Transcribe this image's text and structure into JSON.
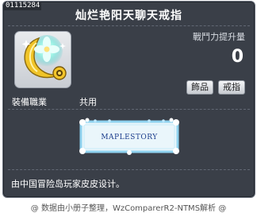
{
  "item": {
    "id": "01115284",
    "name": "灿烂艳阳天聊天戒指",
    "stat_label": "戰鬥力提升量",
    "stat_value": "0",
    "tags": [
      "飾品",
      "戒指"
    ],
    "job_label": "裝備職業",
    "job_value": "共用",
    "ring_text": "MAPLESTORY",
    "description": "由中国冒险岛玩家皮皮设计。"
  },
  "footer": {
    "text": "@ 数据由小册子整理，WzComparerR2-NTMS解析 @"
  },
  "icons": [
    "moon-flower-ring-icon",
    "sparkle-icon"
  ],
  "colors": {
    "panel": "#3a3f48",
    "ring_frame": "#9ad6f0",
    "ring_fill": "#eaf6fb",
    "ring_text": "#1c3d8c"
  }
}
